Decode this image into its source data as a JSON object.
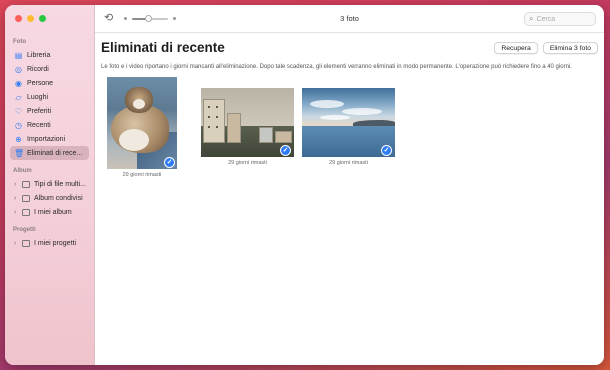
{
  "sidebar": {
    "sections": {
      "foto": "Foto",
      "album": "Album",
      "progetti": "Progetti"
    },
    "foto_items": [
      {
        "label": "Libreria",
        "icon": "library-icon"
      },
      {
        "label": "Ricordi",
        "icon": "memories-icon"
      },
      {
        "label": "Persone",
        "icon": "people-icon"
      },
      {
        "label": "Luoghi",
        "icon": "places-icon"
      },
      {
        "label": "Preferiti",
        "icon": "heart-icon"
      },
      {
        "label": "Recenti",
        "icon": "clock-icon"
      },
      {
        "label": "Importazioni",
        "icon": "import-icon"
      },
      {
        "label": "Eliminati di rece...",
        "icon": "trash-icon",
        "selected": true
      }
    ],
    "album_items": [
      {
        "label": "Tipi di file multi..."
      },
      {
        "label": "Album condivisi"
      },
      {
        "label": "I miei album"
      }
    ],
    "progetti_items": [
      {
        "label": "I miei progetti"
      }
    ]
  },
  "toolbar": {
    "title": "3 foto",
    "zoom_level": 0.45,
    "search_placeholder": "Cerca"
  },
  "main": {
    "title": "Eliminati di recente",
    "recover_label": "Recupera",
    "delete_all_label": "Elimina 3 foto",
    "description": "Le foto e i video riportano i giorni mancanti all'eliminazione. Dopo tale scadenza, gli elementi verranno eliminati in modo permanente. L'operazione può richiedere fino a 40 giorni.",
    "photos": [
      {
        "caption": "29 giorni rimasti",
        "subject": "cat",
        "selected": true
      },
      {
        "caption": "29 giorni rimasti",
        "subject": "city",
        "selected": true
      },
      {
        "caption": "29 giorni rimasti",
        "subject": "sea",
        "selected": true
      }
    ]
  },
  "colors": {
    "accent": "#2f7cf6",
    "sidebar_bg": "#f4cfd8",
    "window_close": "#fe5f57",
    "window_minimize": "#febc2e",
    "window_zoom": "#28c840"
  }
}
